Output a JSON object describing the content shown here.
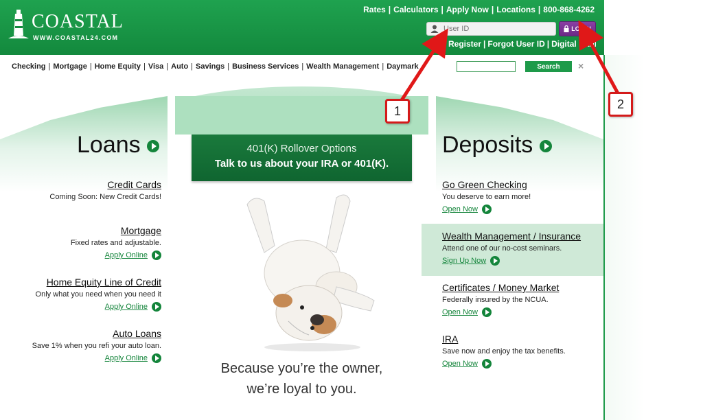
{
  "brand": {
    "name": "COASTAL",
    "url": "WWW.COASTAL24.COM"
  },
  "top_links": [
    "Rates",
    "Calculators",
    "Apply Now",
    "Locations",
    "800-868-4262"
  ],
  "login": {
    "userid_placeholder": "User ID",
    "button_label": "LOGIN"
  },
  "sub_links": [
    "Register",
    "Forgot User ID",
    "Digital Banking"
  ],
  "nav": [
    "Checking",
    "Mortgage",
    "Home Equity",
    "Visa",
    "Auto",
    "Savings",
    "Business Services",
    "Wealth Management",
    "Daymark Realty"
  ],
  "search": {
    "button_label": "Search",
    "close": "×"
  },
  "loans": {
    "title": "Loans",
    "items": [
      {
        "title": "Credit Cards",
        "desc": "Coming Soon: New Credit Cards!",
        "cta": ""
      },
      {
        "title": "Mortgage",
        "desc": "Fixed rates and adjustable.",
        "cta": "Apply Online"
      },
      {
        "title": "Home Equity Line of Credit",
        "desc": "Only what you need when you need it",
        "cta": "Apply Online"
      },
      {
        "title": "Auto Loans",
        "desc": "Save 1% when you refi your auto loan.",
        "cta": "Apply Online"
      }
    ]
  },
  "banner": {
    "line1": "401(K) Rollover Options",
    "line2": "Talk to us about your IRA or 401(K)."
  },
  "tagline": {
    "line1": "Because you’re the owner,",
    "line2": "we’re loyal to you."
  },
  "deposits": {
    "title": "Deposits",
    "items": [
      {
        "title": "Go Green Checking",
        "desc": "You deserve to earn more!",
        "cta": "Open Now"
      },
      {
        "title": "Wealth Management / Insurance",
        "desc": "Attend one of our no-cost seminars.",
        "cta": "Sign Up Now"
      },
      {
        "title": "Certificates / Money Market",
        "desc": "Federally insured by the NCUA.",
        "cta": "Open Now"
      },
      {
        "title": "IRA",
        "desc": "Save now and enjoy the tax benefits.",
        "cta": "Open Now"
      }
    ]
  },
  "callouts": [
    "1",
    "2"
  ],
  "colors": {
    "brand_green": "#1e9a4a",
    "login_purple": "#7a3296",
    "callout_red": "#d41a1a"
  }
}
